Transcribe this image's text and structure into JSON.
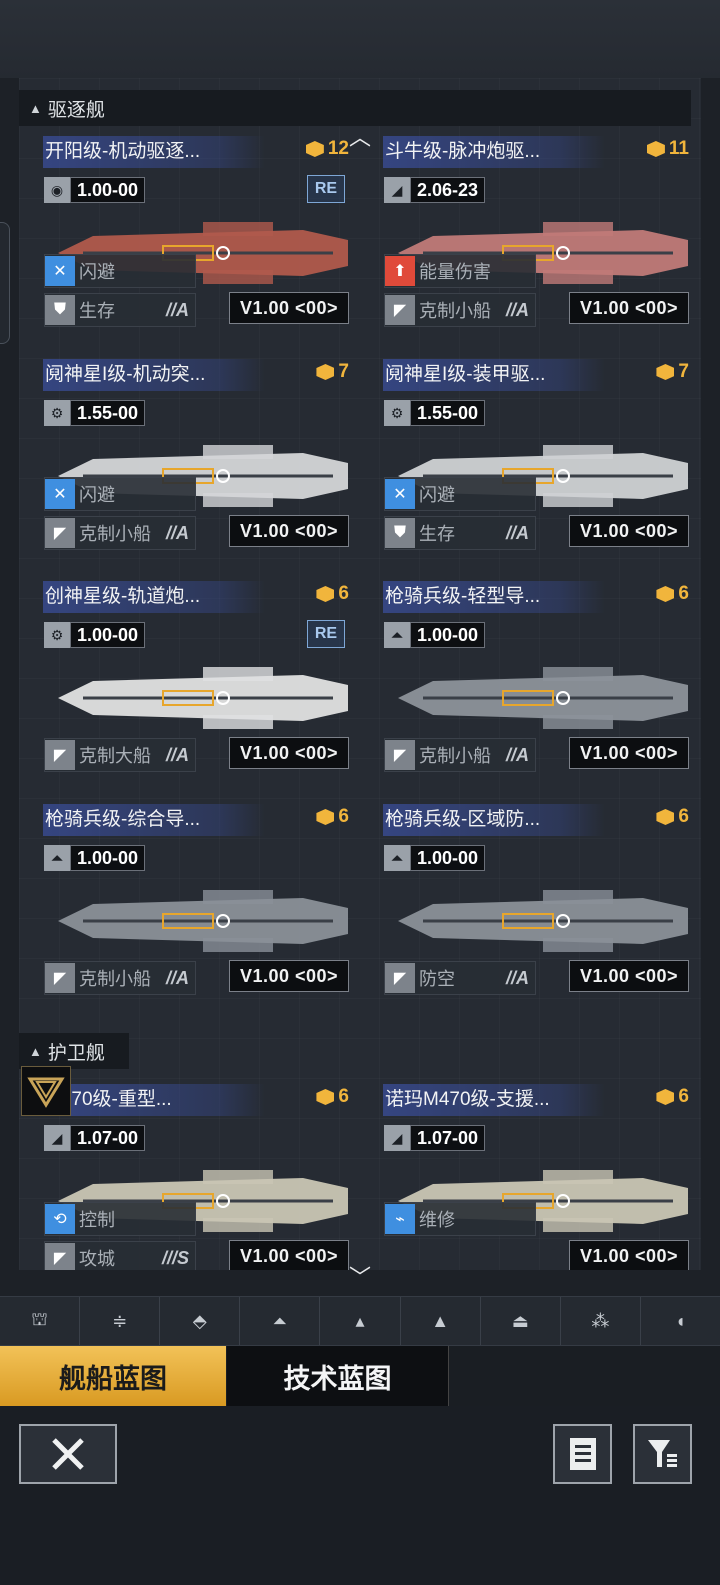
{
  "sections": {
    "destroyer": "驱逐舰",
    "frigate": "护卫舰"
  },
  "cards": [
    {
      "name": "开阳级-机动驱逐...",
      "cost": "12",
      "value": "1.00-00",
      "re": "RE",
      "tag1": "闪避",
      "tag1_grade": "",
      "tag2": "生存",
      "tag2_grade": "//A",
      "version": "V1.00 <00>",
      "hull": "#b05a4c",
      "icon": "energy-icon"
    },
    {
      "name": "斗牛级-脉冲炮驱...",
      "cost": "11",
      "value": "2.06-23",
      "re": "",
      "tag1": "能量伤害",
      "tag1_grade": "",
      "tag2": "克制小船",
      "tag2_grade": "//A",
      "version": "V1.00 <00>",
      "hull": "#c07a78",
      "icon": "missile-icon"
    },
    {
      "name": "阋神星I级-机动突...",
      "cost": "7",
      "value": "1.55-00",
      "re": "",
      "tag1": "闪避",
      "tag1_grade": "",
      "tag2": "克制小船",
      "tag2_grade": "//A",
      "version": "V1.00 <00>",
      "hull": "#d4d6d8",
      "icon": "gear-icon"
    },
    {
      "name": "阋神星I级-装甲驱...",
      "cost": "7",
      "value": "1.55-00",
      "re": "",
      "tag1": "闪避",
      "tag1_grade": "",
      "tag2": "生存",
      "tag2_grade": "//A",
      "version": "V1.00 <00>",
      "hull": "#cfd2d4",
      "icon": "gear-icon"
    },
    {
      "name": "创神星级-轨道炮...",
      "cost": "6",
      "value": "1.00-00",
      "re": "RE",
      "tag1": "",
      "tag1_grade": "",
      "tag2": "克制大船",
      "tag2_grade": "//A",
      "version": "V1.00 <00>",
      "hull": "#e0e1e2",
      "icon": "gear-icon"
    },
    {
      "name": "枪骑兵级-轻型导...",
      "cost": "6",
      "value": "1.00-00",
      "re": "",
      "tag1": "",
      "tag1_grade": "",
      "tag2": "克制小船",
      "tag2_grade": "//A",
      "version": "V1.00 <00>",
      "hull": "#8c929a",
      "icon": "rocket-icon"
    },
    {
      "name": "枪骑兵级-综合导...",
      "cost": "6",
      "value": "1.00-00",
      "re": "",
      "tag1": "",
      "tag1_grade": "",
      "tag2": "克制小船",
      "tag2_grade": "//A",
      "version": "V1.00 <00>",
      "hull": "#8a9098",
      "icon": "rocket-icon"
    },
    {
      "name": "枪骑兵级-区域防...",
      "cost": "6",
      "value": "1.00-00",
      "re": "",
      "tag1": "",
      "tag1_grade": "",
      "tag2": "防空",
      "tag2_grade": "//A",
      "version": "V1.00 <00>",
      "hull": "#8a9098",
      "icon": "rocket-icon"
    },
    {
      "name": "M470级-重型...",
      "cost": "6",
      "value": "1.07-00",
      "re": "",
      "tag1": "控制",
      "tag1_grade": "",
      "tag2": "攻城",
      "tag2_grade": "///S",
      "version": "V1.00 <00>",
      "hull": "#c9c6b4",
      "icon": "missile-icon"
    },
    {
      "name": "诺玛M470级-支援...",
      "cost": "6",
      "value": "1.07-00",
      "re": "",
      "tag1": "维修",
      "tag1_grade": "",
      "tag2": "",
      "tag2_grade": "",
      "version": "V1.00 <00>",
      "hull": "#c9c6b4",
      "icon": "missile-icon"
    }
  ],
  "tabs": {
    "ship": "舰船蓝图",
    "tech": "技术蓝图"
  },
  "colors": {
    "accent": "#f1b53c",
    "tag_blue": "#3a4e9b"
  }
}
